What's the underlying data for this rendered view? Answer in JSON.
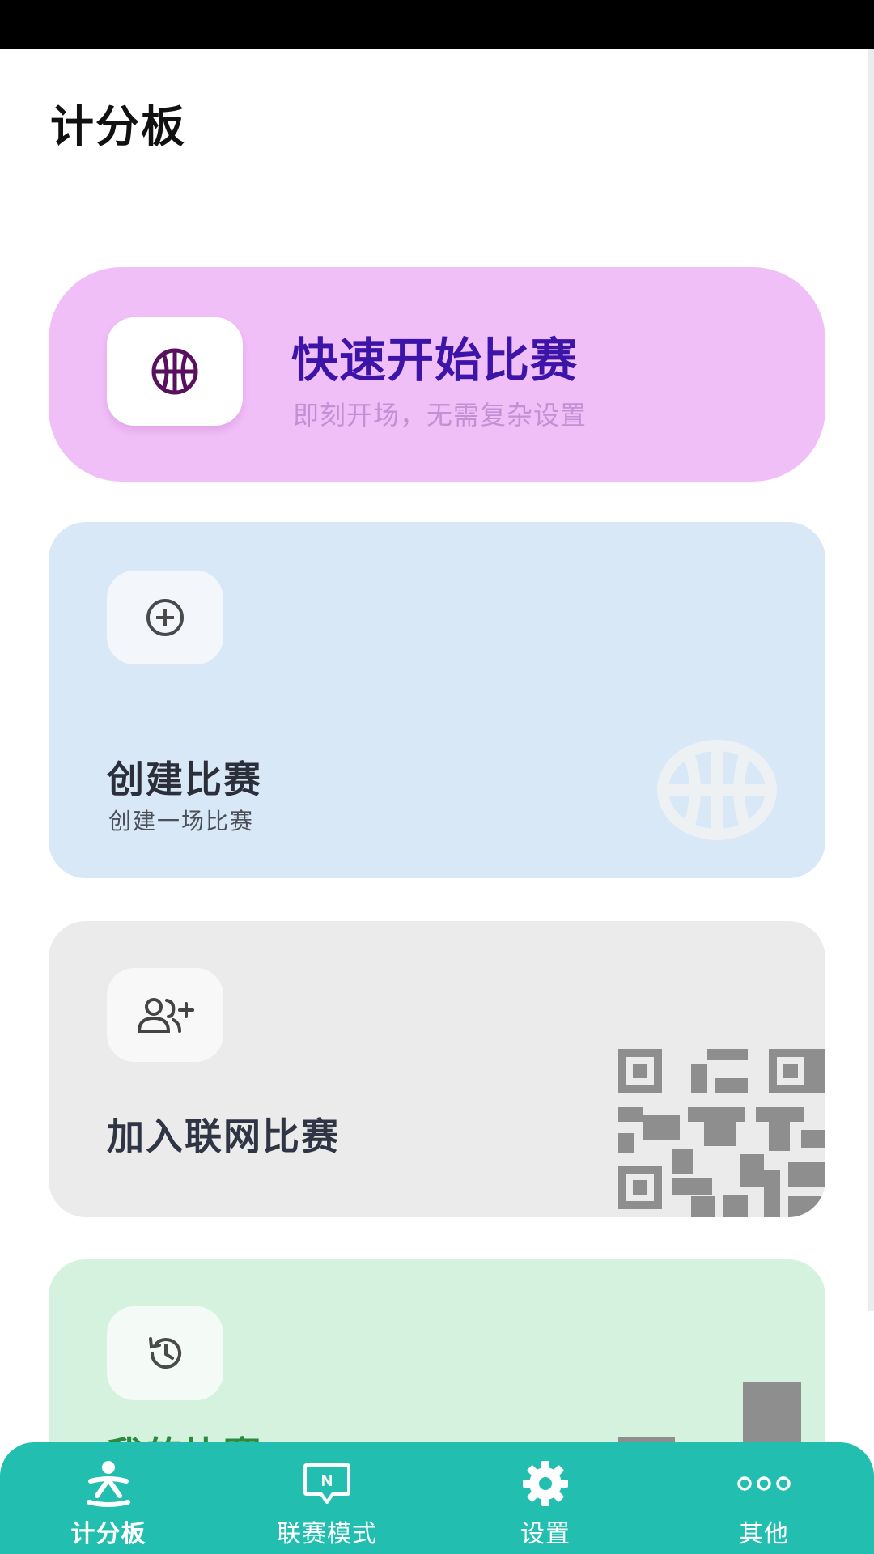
{
  "app": {
    "title": "计分板"
  },
  "cards": {
    "quick_start": {
      "title": "快速开始比赛",
      "subtitle": "即刻开场，无需复杂设置",
      "icon": "basketball-icon"
    },
    "create": {
      "title": "创建比赛",
      "subtitle": "创建一场比赛",
      "icon": "add-circle-icon"
    },
    "join": {
      "title": "加入联网比赛",
      "icon": "add-person-icon"
    },
    "my_matches": {
      "title": "我的比赛",
      "icon": "history-icon"
    }
  },
  "nav": {
    "items": [
      {
        "label": "计分板",
        "icon": "scoreboard-person-icon",
        "active": true
      },
      {
        "label": "联赛模式",
        "icon": "league-badge-icon",
        "active": false
      },
      {
        "label": "设置",
        "icon": "gear-icon",
        "active": false
      },
      {
        "label": "其他",
        "icon": "more-dots-icon",
        "active": false
      }
    ]
  },
  "colors": {
    "nav_bg": "#22bfb0",
    "quick_bg": "#f1bff8",
    "quick_title": "#3d14a8",
    "create_bg": "#d8e8f6",
    "join_bg": "#ebebeb",
    "mine_bg": "#d4f2de",
    "mine_title": "#2a8a3e"
  }
}
